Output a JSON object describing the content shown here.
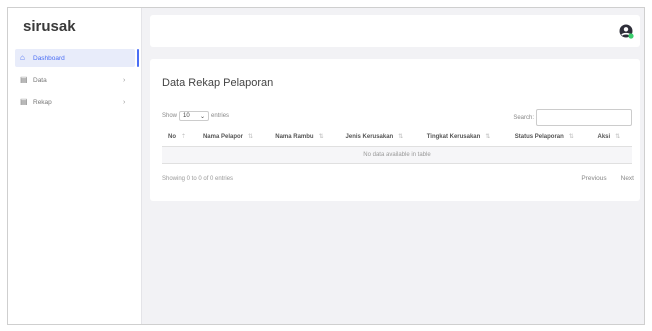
{
  "app": {
    "brand": "sirusak"
  },
  "sidebar": {
    "items": [
      {
        "label": "Dashboard",
        "icon": "home-icon",
        "active": true,
        "has_submenu": false
      },
      {
        "label": "Data",
        "icon": "table-icon",
        "active": false,
        "has_submenu": true
      },
      {
        "label": "Rekap",
        "icon": "table-icon",
        "active": false,
        "has_submenu": true
      }
    ]
  },
  "header": {
    "user_icon": "user-circle-icon",
    "status_color": "#3ccf6e"
  },
  "main": {
    "card_title": "Data Rekap Pelaporan",
    "show_label": "Show",
    "entries_value": "10",
    "entries_label": "entries",
    "search_label": "Search:",
    "search_value": "",
    "table": {
      "columns": [
        "No",
        "Nama Pelapor",
        "Nama Rambu",
        "Jenis Kerusakan",
        "Tingkat Kerusakan",
        "Status Pelaporan",
        "Aksi"
      ],
      "empty_message": "No data available in table"
    },
    "info_text": "Showing 0 to 0 of 0 entries",
    "pagination": {
      "previous": "Previous",
      "next": "Next"
    }
  },
  "colors": {
    "accent": "#4b6ef5",
    "background": "#f2f2f5"
  }
}
